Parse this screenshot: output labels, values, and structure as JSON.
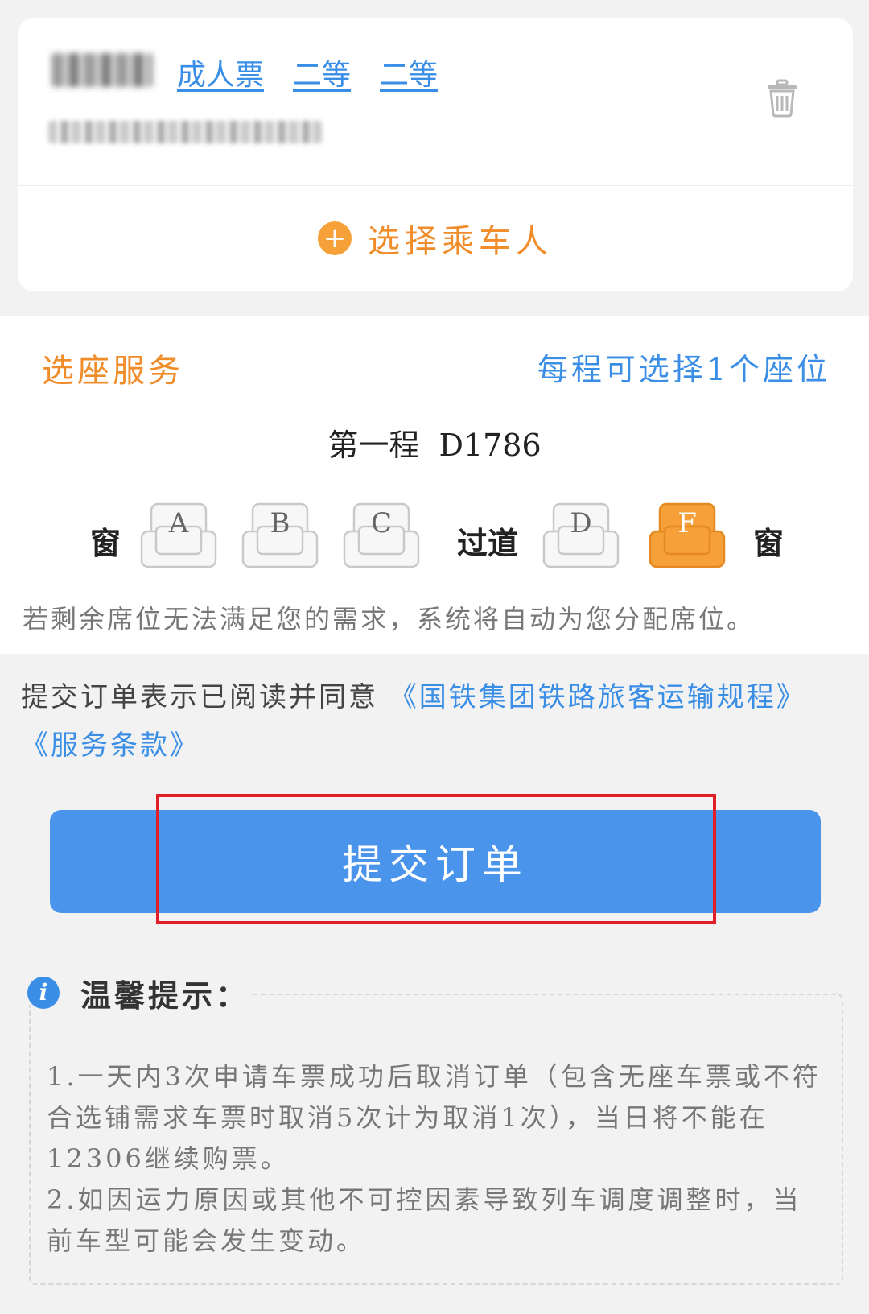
{
  "passenger": {
    "ticket_type": "成人票",
    "seat_class_1": "二等",
    "seat_class_2": "二等",
    "delete_icon": "trash-icon",
    "select_passenger_label": "选择乘车人",
    "add_icon": "plus-circle-icon"
  },
  "seat_service": {
    "title": "选座服务",
    "hint": "每程可选择1个座位",
    "trip_label": "第一程  D1786",
    "window_left": "窗",
    "aisle": "过道",
    "window_right": "窗",
    "seats": [
      {
        "letter": "A",
        "selected": false
      },
      {
        "letter": "B",
        "selected": false
      },
      {
        "letter": "C",
        "selected": false
      },
      {
        "letter": "D",
        "selected": false
      },
      {
        "letter": "F",
        "selected": true
      }
    ],
    "note": "若剩余席位无法满足您的需求，系统将自动为您分配席位。"
  },
  "agreement": {
    "prefix": "提交订单表示已阅读并同意 ",
    "link_rules": "《国铁集团铁路旅客运输规程》",
    "link_terms": "《服务条款》"
  },
  "submit": {
    "label": "提交订单"
  },
  "tips": {
    "icon": "info-icon",
    "icon_glyph": "i",
    "title": "温馨提示：",
    "item_1": "1.一天内3次申请车票成功后取消订单（包含无座车票或不符合选铺需求车票时取消5次计为取消1次），当日将不能在12306继续购票。",
    "item_2": "2.如因运力原因或其他不可控因素导致列车调度调整时，当前车型可能会发生变动。"
  },
  "colors": {
    "accent_orange": "#f08c2a",
    "link_blue": "#3a8ee6",
    "button_blue": "#4a94ec",
    "highlight_red": "#e21f26",
    "seat_selected": "#f5a038"
  }
}
